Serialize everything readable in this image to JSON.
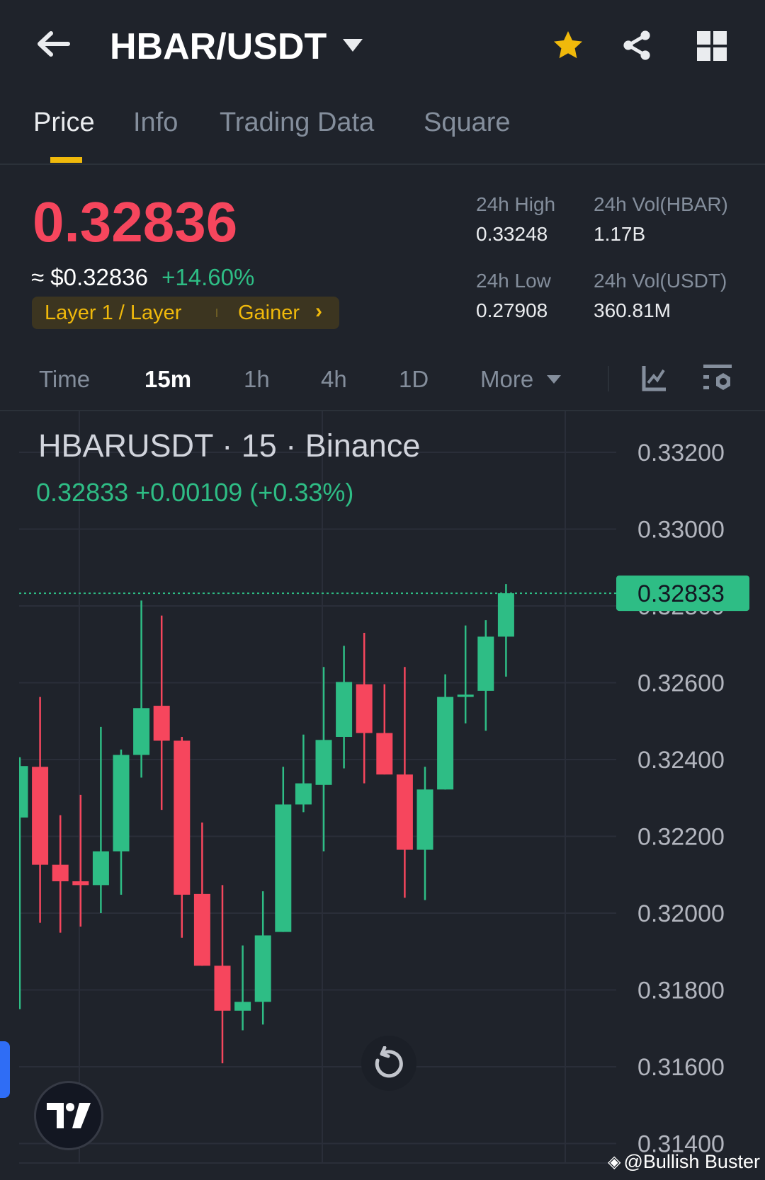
{
  "header": {
    "title": "HBAR/USDT",
    "back_icon": "arrow-left-icon",
    "favorite_color": "#f0b90b"
  },
  "tabs": [
    {
      "label": "Price"
    },
    {
      "label": "Info"
    },
    {
      "label": "Trading Data"
    },
    {
      "label": "Square"
    }
  ],
  "ticker": {
    "last_price": "0.32836",
    "usd_price": "≈ $0.32836",
    "change": "+14.60%",
    "tag1": "Layer 1 / Layer",
    "tag2": "Gainer",
    "stats": {
      "high_label": "24h High",
      "high": "0.33248",
      "low_label": "24h Low",
      "low": "0.27908",
      "vol_base_label": "24h Vol(HBAR)",
      "vol_base": "1.17B",
      "vol_quote_label": "24h Vol(USDT)",
      "vol_quote": "360.81M"
    }
  },
  "intervals": [
    {
      "label": "Time"
    },
    {
      "label": "15m"
    },
    {
      "label": "1h"
    },
    {
      "label": "4h"
    },
    {
      "label": "1D"
    },
    {
      "label": "More"
    }
  ],
  "chart": {
    "title": "HBARUSDT · 15 · Binance",
    "quote": "0.32833  +0.00109 (+0.33%)",
    "watermark": "@Bullish Buster"
  },
  "chart_data": {
    "type": "candlestick",
    "title": "HBARUSDT · 15 · Binance",
    "ylim": [
      0.3136,
      0.3331
    ],
    "yticks": [
      "0.33200",
      "0.33000",
      "0.32800",
      "0.32600",
      "0.32400",
      "0.32200",
      "0.32000",
      "0.31800",
      "0.31600",
      "0.31400"
    ],
    "last_price": "0.32833",
    "colors": {
      "up": "#2ebd85",
      "down": "#f6465d"
    },
    "candles": [
      {
        "o": 0.32249,
        "h": 0.32406,
        "l": 0.3175,
        "c": 0.32383
      },
      {
        "o": 0.32381,
        "h": 0.32563,
        "l": 0.31975,
        "c": 0.32126
      },
      {
        "o": 0.32126,
        "h": 0.32255,
        "l": 0.31949,
        "c": 0.32083
      },
      {
        "o": 0.32083,
        "h": 0.32308,
        "l": 0.31965,
        "c": 0.32073
      },
      {
        "o": 0.32073,
        "h": 0.32485,
        "l": 0.32,
        "c": 0.32161
      },
      {
        "o": 0.32161,
        "h": 0.32426,
        "l": 0.32048,
        "c": 0.32412
      },
      {
        "o": 0.32412,
        "h": 0.32814,
        "l": 0.32353,
        "c": 0.32534
      },
      {
        "o": 0.3254,
        "h": 0.32775,
        "l": 0.32269,
        "c": 0.32449
      },
      {
        "o": 0.32449,
        "h": 0.32459,
        "l": 0.31936,
        "c": 0.32048
      },
      {
        "o": 0.3205,
        "h": 0.32236,
        "l": 0.31863,
        "c": 0.31863
      },
      {
        "o": 0.31863,
        "h": 0.32073,
        "l": 0.31609,
        "c": 0.31746
      },
      {
        "o": 0.31746,
        "h": 0.31916,
        "l": 0.31695,
        "c": 0.31769
      },
      {
        "o": 0.31769,
        "h": 0.32057,
        "l": 0.3171,
        "c": 0.31942
      },
      {
        "o": 0.31951,
        "h": 0.32381,
        "l": 0.31951,
        "c": 0.32283
      },
      {
        "o": 0.32283,
        "h": 0.32465,
        "l": 0.32263,
        "c": 0.32338
      },
      {
        "o": 0.32334,
        "h": 0.32641,
        "l": 0.32161,
        "c": 0.32451
      },
      {
        "o": 0.32459,
        "h": 0.32696,
        "l": 0.32377,
        "c": 0.32602
      },
      {
        "o": 0.32596,
        "h": 0.3273,
        "l": 0.32338,
        "c": 0.32469
      },
      {
        "o": 0.32469,
        "h": 0.32596,
        "l": 0.32361,
        "c": 0.32361
      },
      {
        "o": 0.32361,
        "h": 0.32641,
        "l": 0.3204,
        "c": 0.32165
      },
      {
        "o": 0.32165,
        "h": 0.32381,
        "l": 0.32034,
        "c": 0.32322
      },
      {
        "o": 0.32322,
        "h": 0.32622,
        "l": 0.32322,
        "c": 0.32563
      },
      {
        "o": 0.32563,
        "h": 0.32749,
        "l": 0.32494,
        "c": 0.32569
      },
      {
        "o": 0.32579,
        "h": 0.32763,
        "l": 0.32475,
        "c": 0.3272
      },
      {
        "o": 0.3272,
        "h": 0.32857,
        "l": 0.32616,
        "c": 0.32833
      }
    ]
  }
}
